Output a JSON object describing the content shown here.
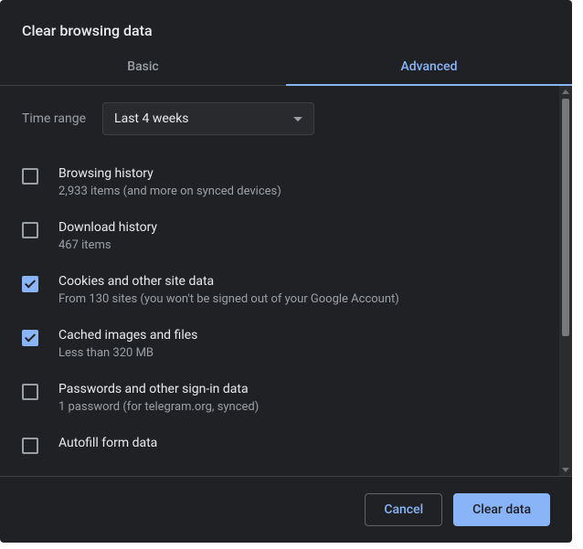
{
  "dialog": {
    "title": "Clear browsing data"
  },
  "tabs": {
    "basic": {
      "label": "Basic",
      "active": false
    },
    "advanced": {
      "label": "Advanced",
      "active": true
    }
  },
  "time_range": {
    "label": "Time range",
    "selected": "Last 4 weeks"
  },
  "options": [
    {
      "id": "browsing-history",
      "checked": false,
      "title": "Browsing history",
      "subtitle": "2,933 items (and more on synced devices)"
    },
    {
      "id": "download-history",
      "checked": false,
      "title": "Download history",
      "subtitle": "467 items"
    },
    {
      "id": "cookies",
      "checked": true,
      "title": "Cookies and other site data",
      "subtitle": "From 130 sites (you won't be signed out of your Google Account)"
    },
    {
      "id": "cached",
      "checked": true,
      "title": "Cached images and files",
      "subtitle": "Less than 320 MB"
    },
    {
      "id": "passwords",
      "checked": false,
      "title": "Passwords and other sign-in data",
      "subtitle": "1 password (for telegram.org, synced)"
    },
    {
      "id": "autofill",
      "checked": false,
      "title": "Autofill form data",
      "subtitle": ""
    }
  ],
  "footer": {
    "cancel": "Cancel",
    "confirm": "Clear data"
  }
}
